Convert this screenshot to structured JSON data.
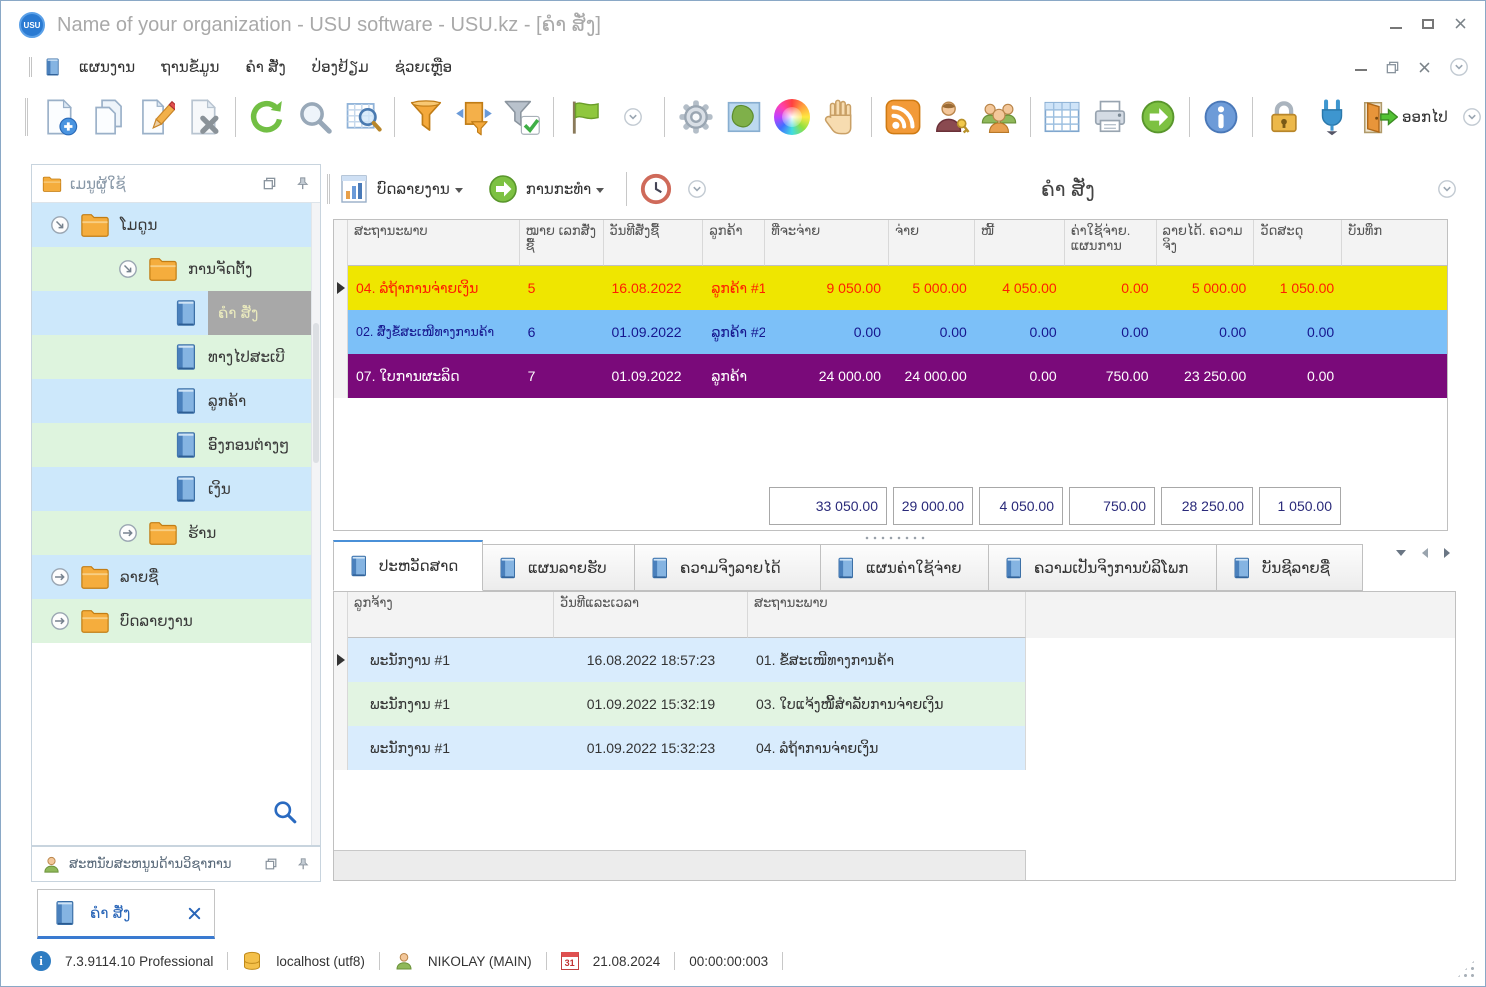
{
  "window": {
    "title": "Name of your organization - USU software - USU.kz - [ຄໍາ ສັ່ງ]",
    "logo": "USU"
  },
  "menubar": {
    "items": [
      "ແຜນງານ",
      "ຖານຂໍ້ມູນ",
      "ຄໍາ ສັ່ງ",
      "ປ່ອງຢ້ຽມ",
      "ຊ່ວຍເຫຼືອ"
    ]
  },
  "toolbar": {
    "exit_label": "ອອກໄປ"
  },
  "sidebar": {
    "header": "ເມນູຜູ້ໃຊ້",
    "items": [
      "ໂມດູນ",
      "ການຈັດຕັ້ງ",
      "ຄໍາ ສັ່ງ",
      "ທາງໄປສະເບີ",
      "ລູກຄ້າ",
      "ອົງກອນຕ່າງໆ",
      "ເງິນ",
      "ຮ້ານ",
      "ລາຍຊື່",
      "ບົດລາຍງານ"
    ],
    "support_panel": "ສະຫນັບສະຫນູນດ້ານວິຊາການ"
  },
  "content": {
    "reports_button": "ບົດລາຍງານ",
    "actions_button": "ການກະທໍາ",
    "page_title": "ຄໍາ ສັ່ງ"
  },
  "orders_table": {
    "columns": [
      "ສະຖານະພາບ",
      "ໝາຍ ເລກສັ່ງຊື້",
      "ວັນທີສັ່ງຊື້",
      "ລູກຄ້າ",
      "ທີ່ຈະຈ່າຍ",
      "ຈ່າຍ",
      "ໜີ້",
      "ຄ່າໃຊ້ຈ່າຍ. ແຜນການ",
      "ລາຍໄດ້. ຄວາມຈິງ",
      "ວັດສະດຸ",
      "ບັນທຶກ"
    ],
    "rows": [
      {
        "status": "04. ລໍຖ້າການຈ່າຍເງິນ",
        "number": "5",
        "date": "16.08.2022",
        "customer": "ລູກຄ້າ #1",
        "to_pay": "9 050.00",
        "paid": "5 000.00",
        "debt": "4 050.00",
        "expenses": "0.00",
        "income": "5 000.00",
        "materials": "1 050.00",
        "note": ""
      },
      {
        "status": "02. ສົ່ງຂໍ້ສະເໜີທາງການຄ້າ",
        "number": "6",
        "date": "01.09.2022",
        "customer": "ລູກຄ້າ #2",
        "to_pay": "0.00",
        "paid": "0.00",
        "debt": "0.00",
        "expenses": "0.00",
        "income": "0.00",
        "materials": "0.00",
        "note": ""
      },
      {
        "status": "07. ໃບການຜະລິດ",
        "number": "7",
        "date": "01.09.2022",
        "customer": "ລູກຄ້າ",
        "to_pay": "24 000.00",
        "paid": "24 000.00",
        "debt": "0.00",
        "expenses": "750.00",
        "income": "23 250.00",
        "materials": "0.00",
        "note": ""
      }
    ],
    "totals": [
      "33 050.00",
      "29 000.00",
      "4 050.00",
      "750.00",
      "28 250.00",
      "1 050.00"
    ]
  },
  "tabs": {
    "items": [
      "ປະຫວັດສາດ",
      "ແຜນລາຍຮັບ",
      "ຄວາມຈິງລາຍໄດ້",
      "ແຜນຄ່າໃຊ້ຈ່າຍ",
      "ຄວາມເປັນຈິງການບໍລິໂພກ",
      "ບັນຊີລາຍຊື່"
    ]
  },
  "history_table": {
    "columns": [
      "ລູກຈ້າງ",
      "ວັນທີແລະເວລາ",
      "ສະຖານະພາບ"
    ],
    "rows": [
      {
        "employee": "ພະນັກງານ #1",
        "datetime": "16.08.2022 18:57:23",
        "status": "01. ຂໍ້ສະເໜີທາງການຄ້າ"
      },
      {
        "employee": "ພະນັກງານ #1",
        "datetime": "01.09.2022 15:32:19",
        "status": "03. ໃບແຈ້ງໜີ້ສໍາລັບການຈ່າຍເງິນ"
      },
      {
        "employee": "ພະນັກງານ #1",
        "datetime": "01.09.2022 15:32:23",
        "status": "04. ລໍຖ້າການຈ່າຍເງິນ"
      }
    ]
  },
  "doc_tab": {
    "label": "ຄໍາ ສັ່ງ"
  },
  "statusbar": {
    "version": "7.3.9114.10 Professional",
    "database": "localhost (utf8)",
    "user": "NIKOLAY (MAIN)",
    "calendar_day": "31",
    "date": "21.08.2024",
    "timer": "00:00:00:003"
  },
  "colors": {
    "row_yellow": "#efe600",
    "row_yellow_text": "#ff1f00",
    "row_blue": "#7cc0f8",
    "row_blue_text": "#16168e",
    "row_purple": "#7a0a7a",
    "row_purple_text": "#ffffff",
    "tree_blue": "#cde8fb",
    "tree_green": "#def4de",
    "accent": "#3a7ad0"
  }
}
